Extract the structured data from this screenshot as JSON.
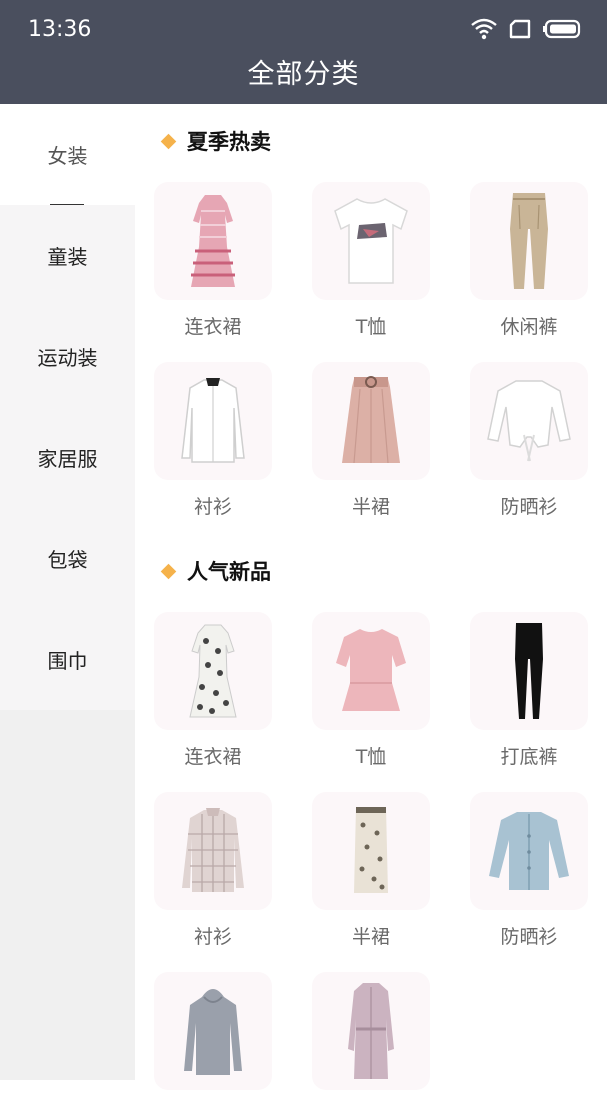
{
  "status": {
    "time": "13:36"
  },
  "header": {
    "title": "全部分类"
  },
  "sidebar": {
    "items": [
      {
        "label": "女装"
      },
      {
        "label": "童装"
      },
      {
        "label": "运动装"
      },
      {
        "label": "家居服"
      },
      {
        "label": "包袋"
      },
      {
        "label": "围巾"
      }
    ]
  },
  "sections": [
    {
      "title": "夏季热卖",
      "items": [
        {
          "label": "连衣裙",
          "icon": "dress-pink-icon"
        },
        {
          "label": "T恤",
          "icon": "tshirt-white-icon"
        },
        {
          "label": "休闲裤",
          "icon": "trousers-khaki-icon"
        },
        {
          "label": "衬衫",
          "icon": "shirt-white-icon"
        },
        {
          "label": "半裙",
          "icon": "skirt-pink-icon"
        },
        {
          "label": "防晒衫",
          "icon": "cardigan-white-icon"
        }
      ]
    },
    {
      "title": "人气新品",
      "items": [
        {
          "label": "连衣裙",
          "icon": "dress-floral-icon"
        },
        {
          "label": "T恤",
          "icon": "blouse-pink-icon"
        },
        {
          "label": "打底裤",
          "icon": "leggings-black-icon"
        },
        {
          "label": "衬衫",
          "icon": "shirt-plaid-icon"
        },
        {
          "label": "半裙",
          "icon": "skirt-patterned-icon"
        },
        {
          "label": "防晒衫",
          "icon": "cardigan-blue-icon"
        },
        {
          "label": "",
          "icon": "hoodie-grey-icon"
        },
        {
          "label": "",
          "icon": "coat-lilac-icon"
        }
      ]
    }
  ]
}
